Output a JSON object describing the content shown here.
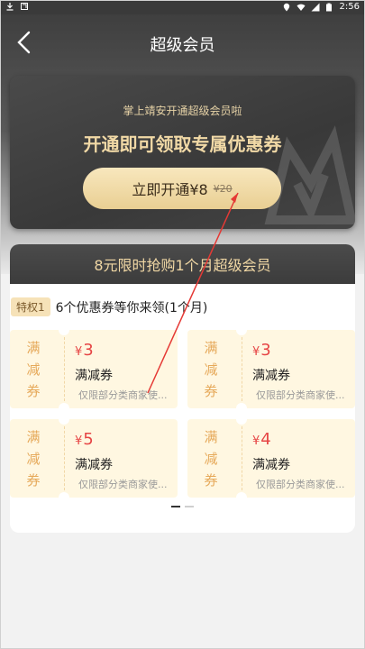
{
  "statusbar": {
    "time": "2:56"
  },
  "header": {
    "title": "超级会员"
  },
  "card": {
    "subtitle": "掌上靖安开通超级会员啦",
    "headline": "开通即可领取专属优惠券",
    "cta_label": "立即开通¥8",
    "cta_original_price": "¥20"
  },
  "panel": {
    "title": "8元限时抢购1个月超级会员",
    "privilege_tag": "特权1",
    "privilege_text": "6个优惠券等你来领(1个月)",
    "coupons": [
      {
        "type_text": "满减券",
        "currency": "¥",
        "amount": "3",
        "name": "满减券",
        "desc": "仅限部分类商家使..."
      },
      {
        "type_text": "满减券",
        "currency": "¥",
        "amount": "3",
        "name": "满减券",
        "desc": "仅限部分类商家使..."
      },
      {
        "type_text": "满减券",
        "currency": "¥",
        "amount": "5",
        "name": "满减券",
        "desc": "仅限部分类商家使..."
      },
      {
        "type_text": "满减券",
        "currency": "¥",
        "amount": "4",
        "name": "满减券",
        "desc": "仅限部分类商家使..."
      }
    ]
  },
  "colors": {
    "gold_text": "#f1d9a6",
    "cta_bg": "#eed59a",
    "coupon_bg": "#fff7e1",
    "amount_red": "#e64545",
    "annotation_arrow": "#e53935"
  }
}
